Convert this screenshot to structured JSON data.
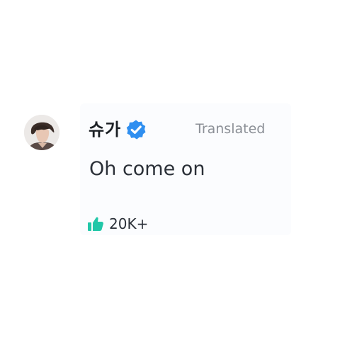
{
  "comment": {
    "author_name": "슈가",
    "verified": true,
    "translated_label": "Translated",
    "text": "Oh come on",
    "like_count": "20K+"
  },
  "colors": {
    "verified_badge": "#2f8ff0",
    "like_icon": "#21c7a8",
    "card_background": "#fbfcfe",
    "secondary_text": "#8b8f96"
  },
  "icons": {
    "avatar": "profile-photo",
    "verified": "verified-badge-icon",
    "like": "thumbs-up-icon"
  }
}
